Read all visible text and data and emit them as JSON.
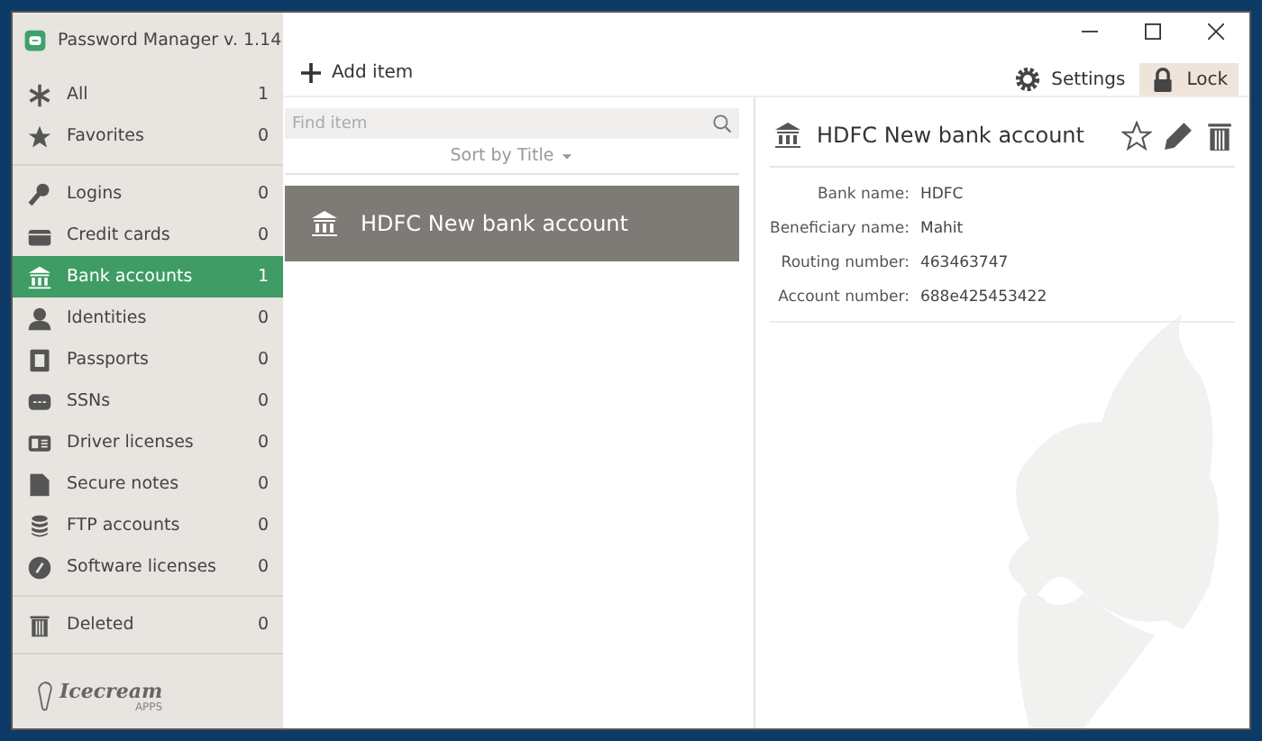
{
  "window": {
    "title": "Password Manager v. 1.14"
  },
  "sidebar": {
    "groups": [
      [
        {
          "kind": "all",
          "label": "All",
          "count": "1",
          "selected": false
        },
        {
          "kind": "favorites",
          "label": "Favorites",
          "count": "0",
          "selected": false
        }
      ],
      [
        {
          "kind": "logins",
          "label": "Logins",
          "count": "0",
          "selected": false
        },
        {
          "kind": "credit",
          "label": "Credit cards",
          "count": "0",
          "selected": false
        },
        {
          "kind": "bank",
          "label": "Bank accounts",
          "count": "1",
          "selected": true
        },
        {
          "kind": "identity",
          "label": "Identities",
          "count": "0",
          "selected": false
        },
        {
          "kind": "passport",
          "label": "Passports",
          "count": "0",
          "selected": false
        },
        {
          "kind": "ssn",
          "label": "SSNs",
          "count": "0",
          "selected": false
        },
        {
          "kind": "driver",
          "label": "Driver licenses",
          "count": "0",
          "selected": false
        },
        {
          "kind": "note",
          "label": "Secure notes",
          "count": "0",
          "selected": false
        },
        {
          "kind": "ftp",
          "label": "FTP accounts",
          "count": "0",
          "selected": false
        },
        {
          "kind": "software",
          "label": "Software licenses",
          "count": "0",
          "selected": false
        }
      ],
      [
        {
          "kind": "deleted",
          "label": "Deleted",
          "count": "0",
          "selected": false
        }
      ]
    ],
    "logo": {
      "name": "Icecream",
      "sub": "APPS"
    }
  },
  "toolbar": {
    "add": "Add item",
    "settings": "Settings",
    "lock": "Lock"
  },
  "list": {
    "search": {
      "placeholder": "Find item"
    },
    "sort": "Sort by Title",
    "items": [
      {
        "title": "HDFC New bank account",
        "selected": true
      }
    ]
  },
  "detail": {
    "title": "HDFC New bank account",
    "fields": [
      {
        "label": "Bank name:",
        "value": "HDFC"
      },
      {
        "label": "Beneficiary name:",
        "value": "Mahit"
      },
      {
        "label": "Routing number:",
        "value": "463463747"
      },
      {
        "label": "Account number:",
        "value": "688e425453422"
      }
    ]
  }
}
